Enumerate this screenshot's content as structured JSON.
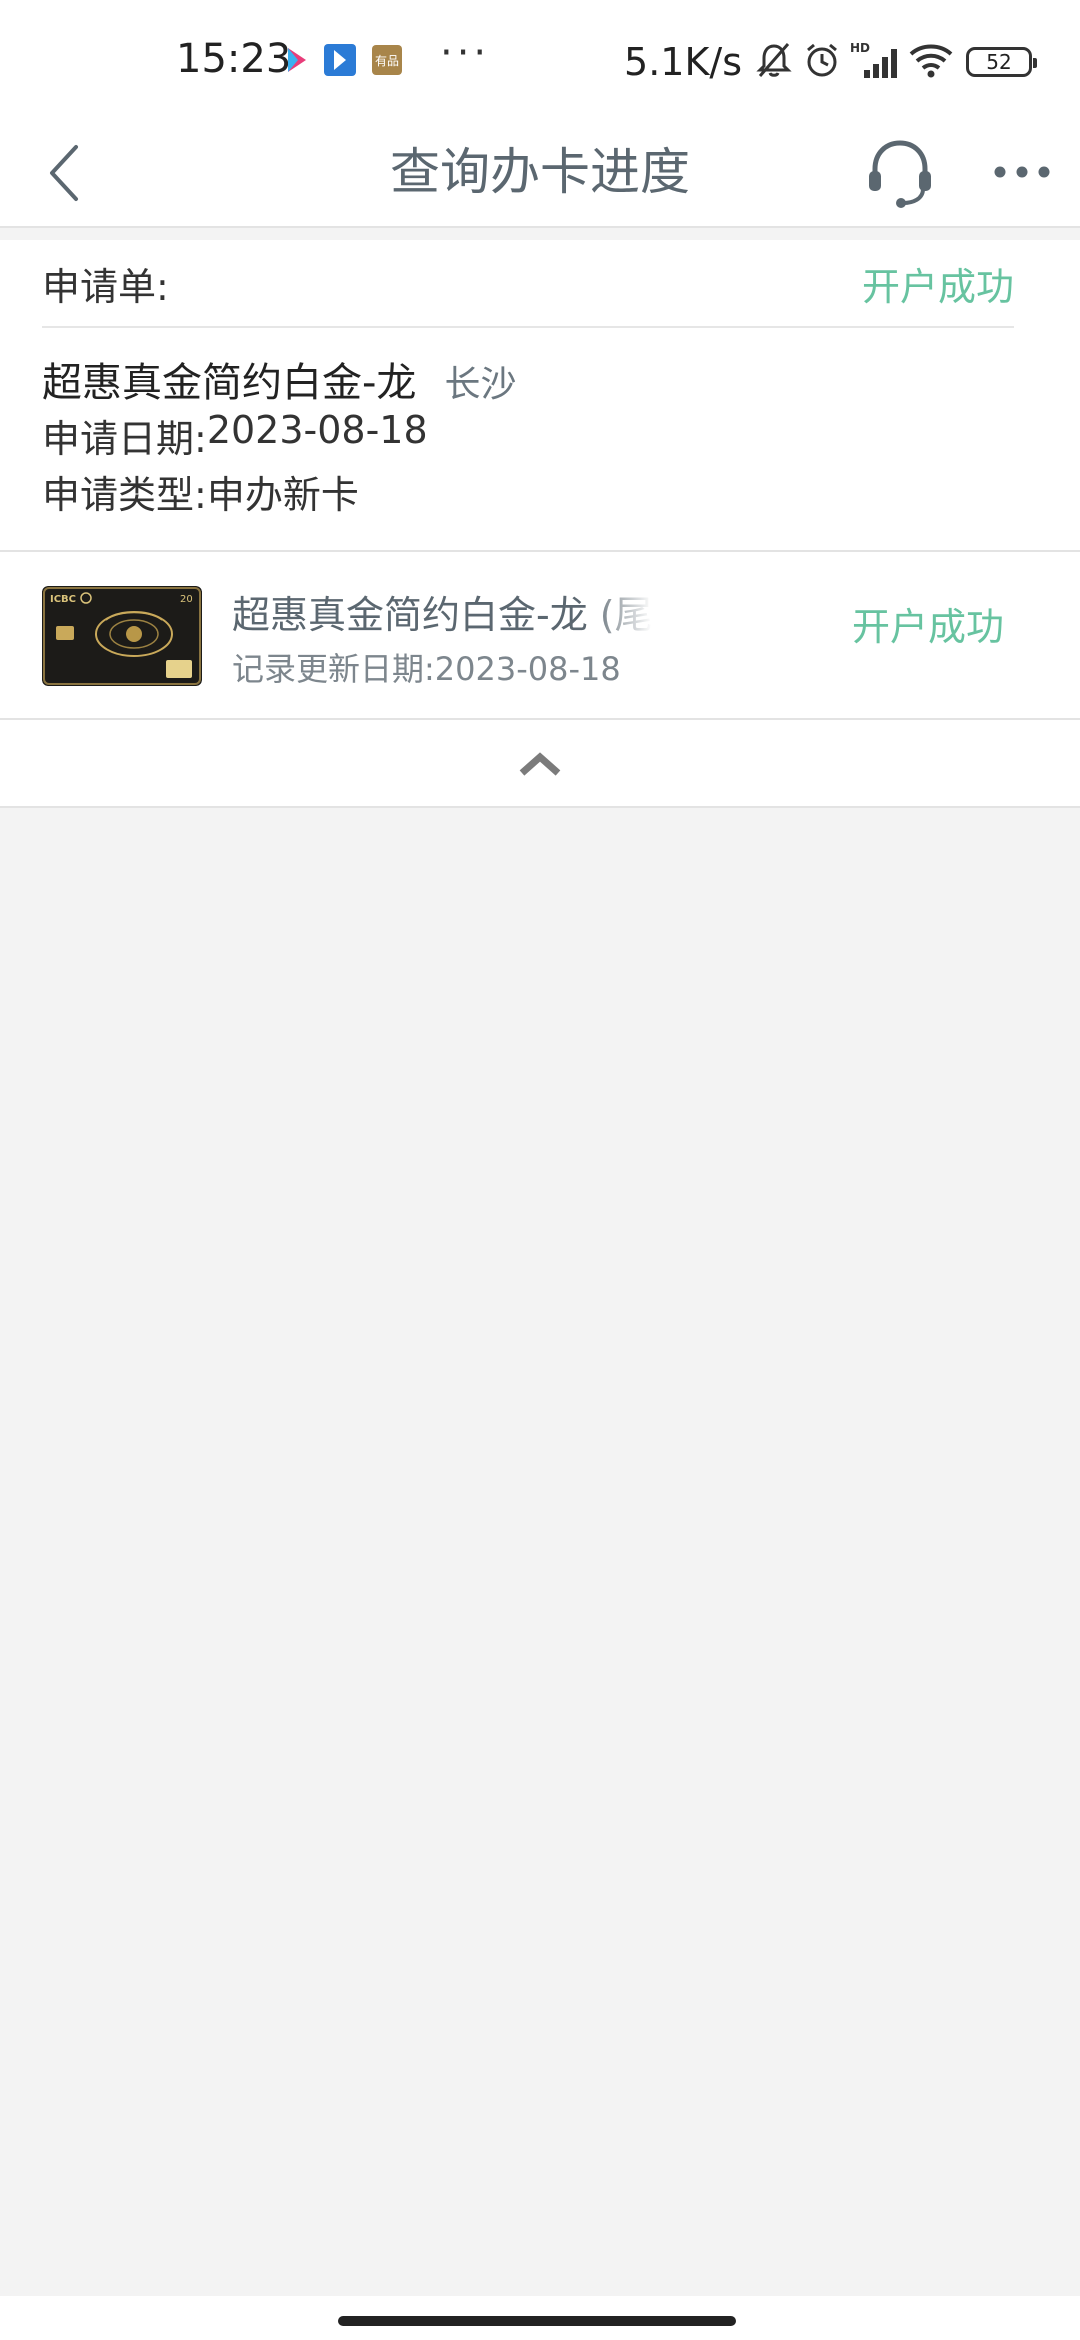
{
  "status_bar": {
    "time": "15:23",
    "more": "···",
    "net_speed": "5.1K/s",
    "battery": "52",
    "app_icons": [
      "video-app-icon",
      "bookmark-app-icon",
      "youpin-app-icon"
    ],
    "youpin_label": "有品",
    "signal_label": "HD"
  },
  "nav": {
    "title": "查询办卡进度"
  },
  "application": {
    "label": "申请单:",
    "status": "开户成功",
    "card_name": "超惠真金简约白金-龙",
    "city": "长沙",
    "date_label": "申请日期:",
    "date_value": "2023-08-18",
    "type_label": "申请类型:",
    "type_value": "申办新卡"
  },
  "card_item": {
    "title": "超惠真金简约白金-龙 (尾",
    "update_label": "记录更新日期:",
    "update_value": "2023-08-18",
    "status": "开户成功",
    "thumb_brand": "ICBC",
    "thumb_number": "20"
  },
  "colors": {
    "success": "#67c3a0",
    "title": "#5b6770",
    "background": "#f3f3f3"
  }
}
